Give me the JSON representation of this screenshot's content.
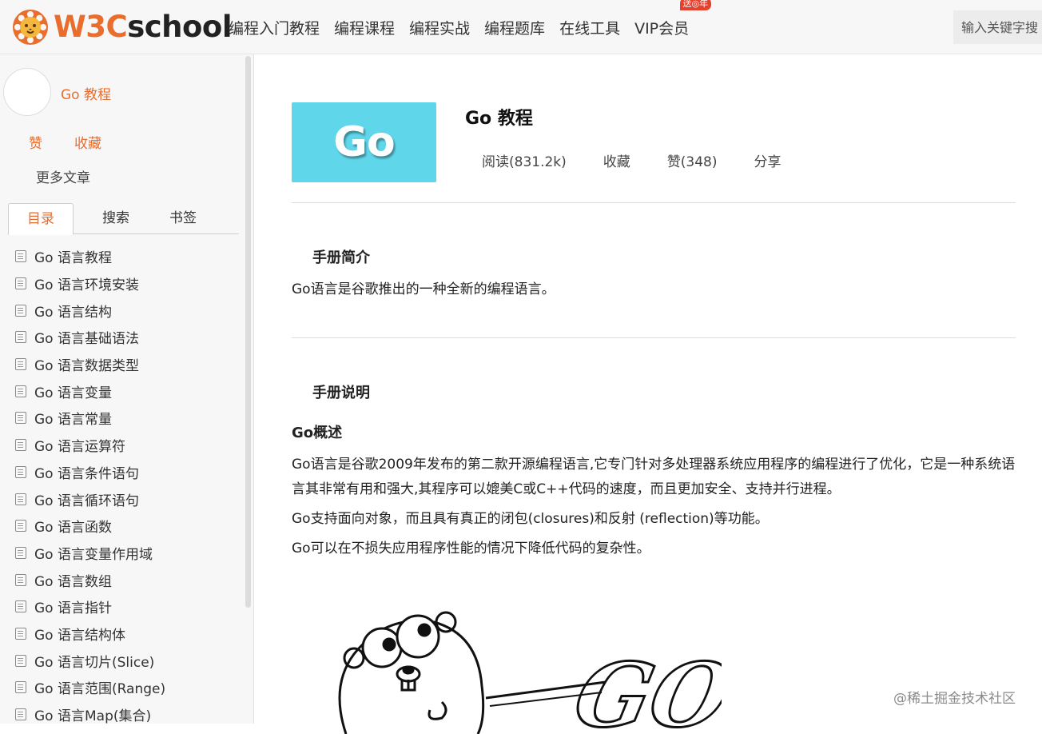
{
  "header": {
    "logo_w3c": "W3C",
    "logo_school": "school",
    "nav": [
      {
        "label": "编程入门教程"
      },
      {
        "label": "编程课程"
      },
      {
        "label": "编程实战"
      },
      {
        "label": "编程题库"
      },
      {
        "label": "在线工具"
      },
      {
        "label": "VIP会员",
        "badge": "送◎年"
      }
    ],
    "search_placeholder": "输入关键字搜"
  },
  "sidebar": {
    "course_title": "Go 教程",
    "like_label": "赞",
    "favorite_label": "收藏",
    "more_label": "更多文章",
    "tabs": [
      {
        "label": "目录",
        "active": true
      },
      {
        "label": "搜索",
        "active": false
      },
      {
        "label": "书签",
        "active": false
      }
    ],
    "toc": [
      "Go 语言教程",
      "Go 语言环境安装",
      "Go 语言结构",
      "Go 语言基础语法",
      "Go 语言数据类型",
      "Go 语言变量",
      "Go 语言常量",
      "Go 语言运算符",
      "Go 语言条件语句",
      "Go 语言循环语句",
      "Go 语言函数",
      "Go 语言变量作用域",
      "Go 语言数组",
      "Go 语言指针",
      "Go 语言结构体",
      "Go 语言切片(Slice)",
      "Go 语言范围(Range)",
      "Go 语言Map(集合)"
    ]
  },
  "main": {
    "banner_text": "Go",
    "title": "Go 教程",
    "stats": {
      "reads": "阅读(831.2k)",
      "favorite": "收藏",
      "likes": "赞(348)",
      "share": "分享"
    },
    "intro_title": "手册简介",
    "intro_text": "Go语言是谷歌推出的一种全新的编程语言。",
    "guide_title": "手册说明",
    "overview_title": "Go概述",
    "overview_p1": "Go语言是谷歌2009年发布的第二款开源编程语言,它专门针对多处理器系统应用程序的编程进行了优化，它是一种系统语言其非常有用和强大,其程序可以媲美C或C++代码的速度，而且更加安全、支持并行进程。",
    "overview_p2": "Go支持面向对象，而且具有真正的闭包(closures)和反射 (reflection)等功能。",
    "overview_p3": "Go可以在不损失应用程序性能的情况下降低代码的复杂性。",
    "illustration_text": "GO"
  },
  "watermark": "@稀土掘金技术社区",
  "colors": {
    "brand": "#e96d2c",
    "banner": "#5fd6ea",
    "badge": "#e5412f"
  }
}
